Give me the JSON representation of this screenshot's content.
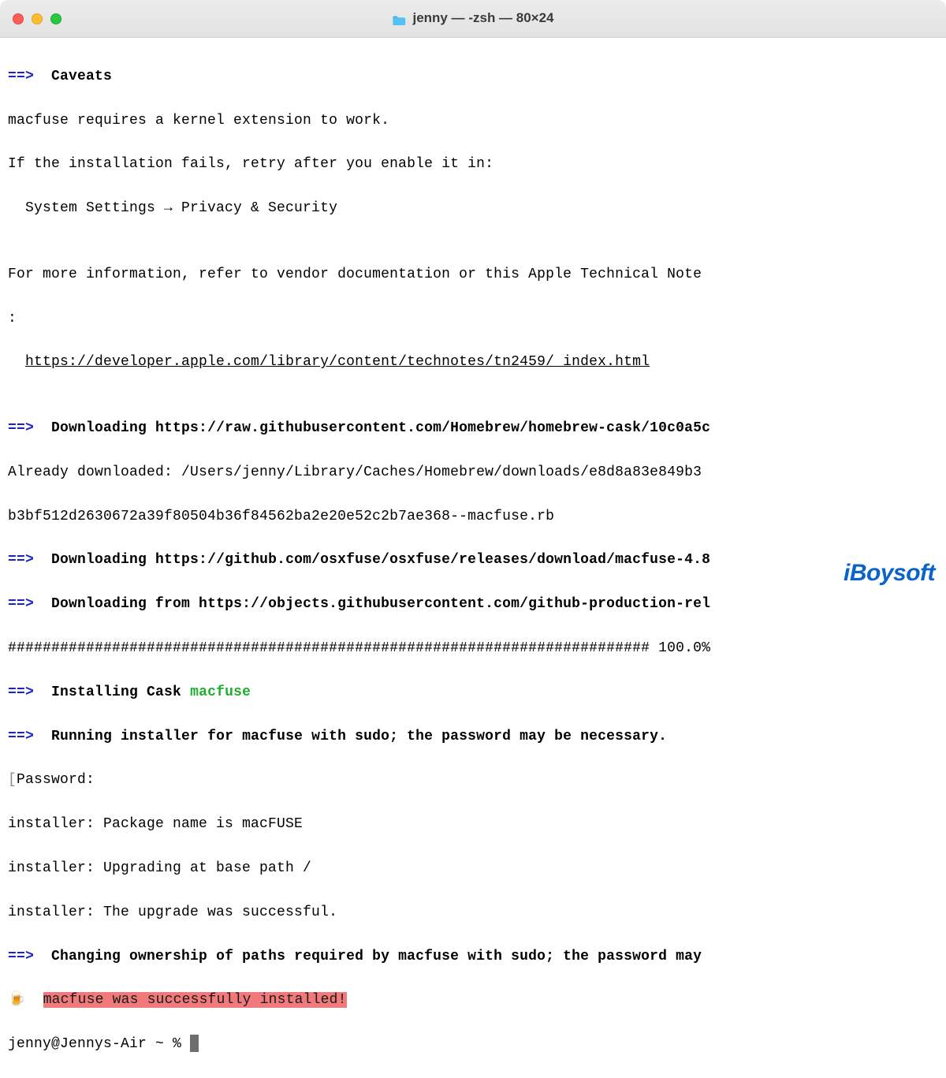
{
  "window": {
    "title": "jenny — -zsh — 80×24"
  },
  "lines": {
    "arrow": "==>",
    "caveats": "Caveats",
    "l1": "macfuse requires a kernel extension to work.",
    "l2": "If the installation fails, retry after you enable it in:",
    "l3": "  System Settings → Privacy & Security",
    "l4": "",
    "l5": "For more information, refer to vendor documentation or this Apple Technical Note",
    "l5b": ":",
    "l6": "  ",
    "l6link": "https://developer.apple.com/library/content/technotes/tn2459/_index.html",
    "l7": "",
    "dl1": "Downloading https://raw.githubusercontent.com/Homebrew/homebrew-cask/10c0a5c",
    "l8": "Already downloaded: /Users/jenny/Library/Caches/Homebrew/downloads/e8d8a83e849b3",
    "l9": "b3bf512d2630672a39f80504b36f84562ba2e20e52c2b7ae368--macfuse.rb",
    "dl2": "Downloading https://github.com/osxfuse/osxfuse/releases/download/macfuse-4.8",
    "dl3": "Downloading from https://objects.githubusercontent.com/github-production-rel",
    "progress": "########################################################################## 100.0%",
    "inst_cask_pre": "Installing Cask ",
    "inst_cask_name": "macfuse",
    "run_installer": "Running installer for macfuse with sudo; the password may be necessary.",
    "pw_bracket_l": "[",
    "pw": "Password:",
    "pw_bracket_r": "]",
    "i1": "installer: Package name is macFUSE",
    "i2": "installer: Upgrading at base path /",
    "i3": "installer: The upgrade was successful.",
    "chown": "Changing ownership of paths required by macfuse with sudo; the password may",
    "beer": "🍺  ",
    "success": "macfuse was successfully installed!",
    "prompt": "jenny@Jennys-Air ~ % "
  },
  "watermark": "iBoysoft"
}
